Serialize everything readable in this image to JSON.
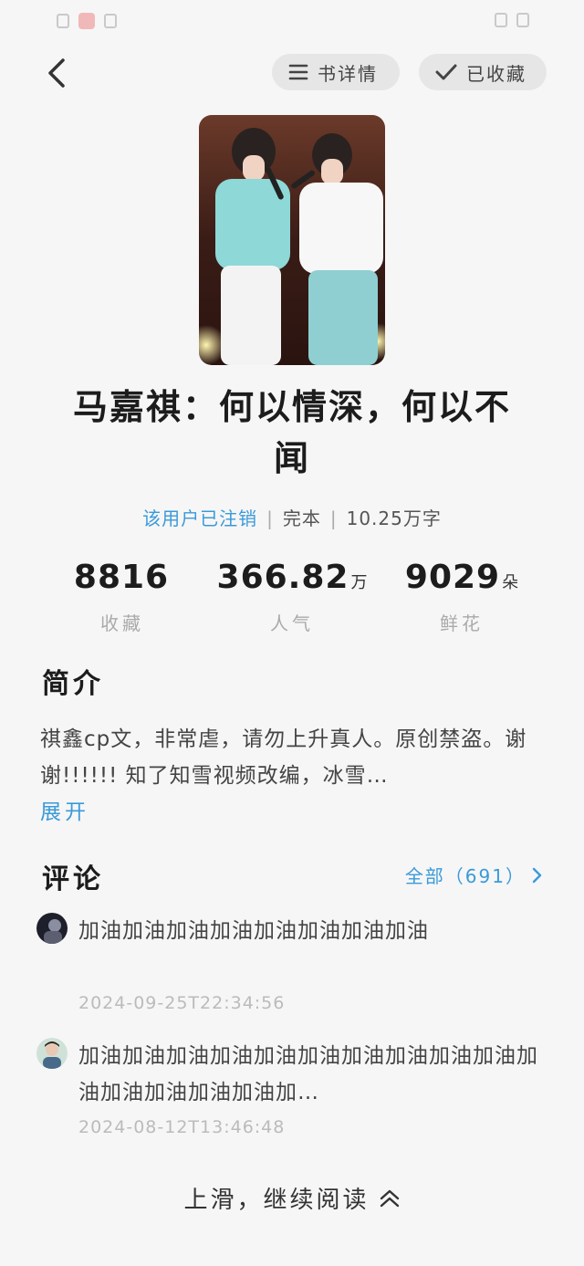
{
  "header": {
    "detail_label": "书详情",
    "favorite_label": "已收藏"
  },
  "book": {
    "title": "马嘉祺：何以情深，何以不闻",
    "author": "该用户已注销",
    "status": "完本",
    "word_count": "10.25万字"
  },
  "stats": [
    {
      "value": "8816",
      "unit": "",
      "label": "收藏"
    },
    {
      "value": "366.82",
      "unit": "万",
      "label": "人气"
    },
    {
      "value": "9029",
      "unit": "朵",
      "label": "鲜花"
    }
  ],
  "intro": {
    "heading": "简介",
    "text": "祺鑫cp文，非常虐，请勿上升真人。原创禁盗。谢谢!!!!!! 知了知雪视频改编，冰雪…",
    "expand_label": "展开"
  },
  "comments": {
    "heading": "评论",
    "all_label": "全部（691）",
    "items": [
      {
        "text": "加油加油加油加油加油加油加油加油",
        "time": "2024-09-25T22:34:56"
      },
      {
        "text": "加油加油加油加油加油加油加油加油加油加油加油加油加油加油加油加…",
        "time": "2024-08-12T13:46:48"
      }
    ]
  },
  "footer": {
    "continue_label": "上滑，继续阅读"
  },
  "colors": {
    "accent": "#3a9ad9",
    "background": "#f6f6f6"
  }
}
